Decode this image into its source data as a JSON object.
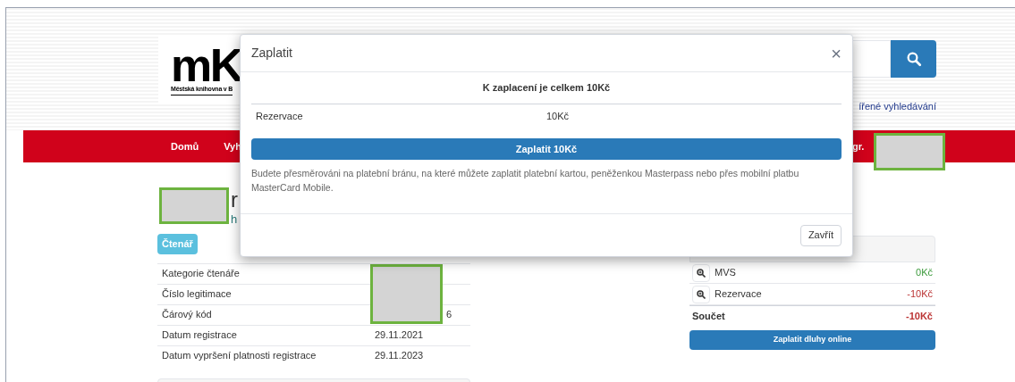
{
  "logo": {
    "mark": "mK",
    "subtitle": "Městská knihovna v B"
  },
  "search": {
    "link": "ířené vyhledávání"
  },
  "nav": {
    "items": [
      "Domů",
      "Vyh"
    ],
    "user": "gr. "
  },
  "profile": {
    "heading": "r",
    "subheading": "h",
    "badge": "Čtenář",
    "rows": [
      {
        "label": "Kategorie čtenáře",
        "value": ""
      },
      {
        "label": "Číslo legitimace",
        "value": ""
      },
      {
        "label": "Čárový kód",
        "value": "6"
      },
      {
        "label": "Datum registrace",
        "value": "29.11.2021"
      },
      {
        "label": "Datum vypršení platnosti registrace",
        "value": "29.11.2023"
      }
    ]
  },
  "debts": {
    "rows": [
      {
        "label": "MVS",
        "amount": "0Kč",
        "kind": "positive"
      },
      {
        "label": "Rezervace",
        "amount": "-10Kč",
        "kind": "negative"
      }
    ],
    "total_label": "Součet",
    "total": "-10Kč",
    "pay_button": "Zaplatit dluhy online"
  },
  "modal": {
    "title": "Zaplatit",
    "close": "×",
    "summary": "K zaplacení je celkem 10Kč",
    "items": [
      {
        "label": "Rezervace",
        "amount": "10Kč"
      }
    ],
    "pay_button": "Zaplatit 10Kč",
    "note": "Budete přesměrováni na platební bránu, na které můžete zaplatit platební kartou, peněženkou Masterpass nebo přes mobilní platbu MasterCard Mobile.",
    "close_button": "Zavřít"
  }
}
